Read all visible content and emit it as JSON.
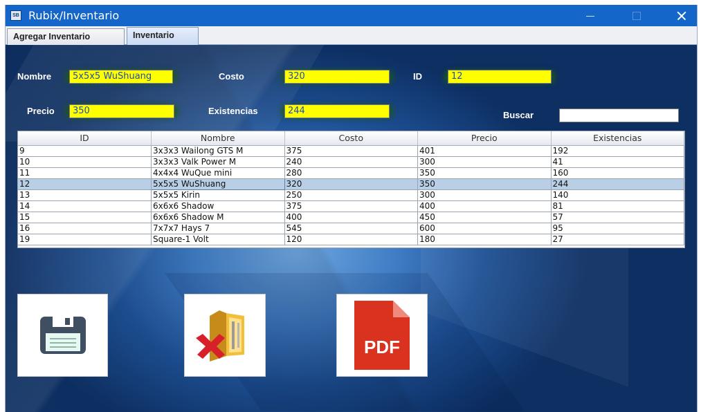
{
  "window": {
    "title": "Rubix/Inventario",
    "app_icon_text": "SB"
  },
  "tabs": [
    {
      "label": "Agregar Inventario",
      "selected": false
    },
    {
      "label": "Inventario",
      "selected": true
    }
  ],
  "form": {
    "nombre_label": "Nombre",
    "nombre_value": "5x5x5 WuShuang",
    "costo_label": "Costo",
    "costo_value": "320",
    "id_label": "ID",
    "id_value": "12",
    "precio_label": "Precio",
    "precio_value": "350",
    "existencias_label": "Existencias",
    "existencias_value": "244",
    "buscar_label": "Buscar",
    "buscar_value": ""
  },
  "table": {
    "columns": [
      "ID",
      "Nombre",
      "Costo",
      "Precio",
      "Existencias"
    ],
    "rows": [
      [
        "9",
        "3x3x3 Wailong GTS M",
        "375",
        "401",
        "192"
      ],
      [
        "10",
        "3x3x3 Valk Power M",
        "240",
        "300",
        "41"
      ],
      [
        "11",
        "4x4x4 WuQue mini",
        "280",
        "350",
        "160"
      ],
      [
        "12",
        "5x5x5 WuShuang",
        "320",
        "350",
        "244"
      ],
      [
        "13",
        "5x5x5 Kirin",
        "250",
        "300",
        "140"
      ],
      [
        "14",
        "6x6x6 Shadow",
        "375",
        "400",
        "81"
      ],
      [
        "15",
        "6x6x6 Shadow M",
        "400",
        "450",
        "57"
      ],
      [
        "16",
        "7x7x7 Hays 7",
        "545",
        "600",
        "95"
      ],
      [
        "19",
        "Square-1 Volt",
        "120",
        "180",
        "27"
      ]
    ],
    "selected_row": 3
  },
  "actions": {
    "pdf_text": "PDF"
  },
  "colors": {
    "titlebar": "#1466c8",
    "field_highlight": "#ffff00",
    "selection": "#b8cfe5",
    "pdf_red": "#d9331f"
  }
}
